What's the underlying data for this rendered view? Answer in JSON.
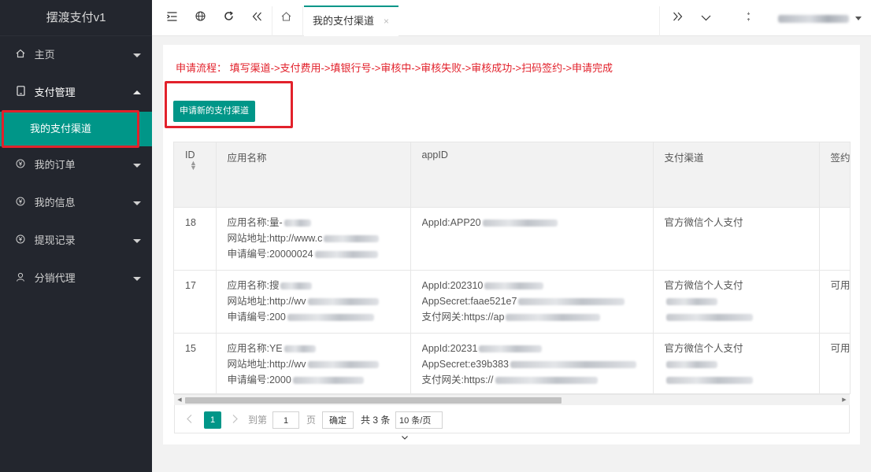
{
  "app": {
    "title": "摆渡支付v1"
  },
  "sidebar": {
    "items": [
      {
        "label": "主页",
        "icon": "home-icon"
      },
      {
        "label": "支付管理",
        "icon": "tablet-icon"
      },
      {
        "label": "我的订单",
        "icon": "yen-icon"
      },
      {
        "label": "我的信息",
        "icon": "yen-icon"
      },
      {
        "label": "提现记录",
        "icon": "yen-icon"
      },
      {
        "label": "分销代理",
        "icon": "user-icon"
      }
    ],
    "sub_item": "我的支付渠道"
  },
  "topbar": {
    "active_tab": "我的支付渠道",
    "tab_close": "×"
  },
  "main": {
    "flow_text": "申请流程： 填写渠道->支付费用->填银行号->审核中->审核失败->审核成功->扫码签约->申请完成",
    "apply_button": "申请新的支付渠道"
  },
  "table": {
    "headers": [
      "ID",
      "应用名称",
      "appID",
      "支付渠道",
      "签约"
    ],
    "rows": [
      {
        "id": "18",
        "app_name": "应用名称:量-",
        "site": "网站地址:http://www.c",
        "apply_no": "申请编号:20000024",
        "appid": "AppId:APP20",
        "secret": "",
        "gateway": "",
        "channel": "官方微信个人支付",
        "sign": ""
      },
      {
        "id": "17",
        "app_name": "应用名称:搜",
        "site": "网站地址:http://wv",
        "apply_no": "申请编号:200",
        "appid": "AppId:202310",
        "secret": "AppSecret:faae521e7",
        "gateway": "支付网关:https://ap",
        "channel": "官方微信个人支付",
        "sign": "可用"
      },
      {
        "id": "15",
        "app_name": "应用名称:YE",
        "site": "网站地址:http://wv",
        "apply_no": "申请编号:2000",
        "appid": "AppId:20231",
        "secret": "AppSecret:e39b383",
        "gateway": "支付网关:https://",
        "channel": "官方微信个人支付",
        "sign": "可用"
      }
    ]
  },
  "pagination": {
    "current_page": "1",
    "goto_label": "到第",
    "goto_value": "1",
    "page_unit": "页",
    "confirm": "确定",
    "total": "共 3 条",
    "page_size": "10 条/页"
  },
  "colors": {
    "accent": "#009688",
    "sidebar_bg": "#23262e",
    "highlight": "#e2212b"
  }
}
